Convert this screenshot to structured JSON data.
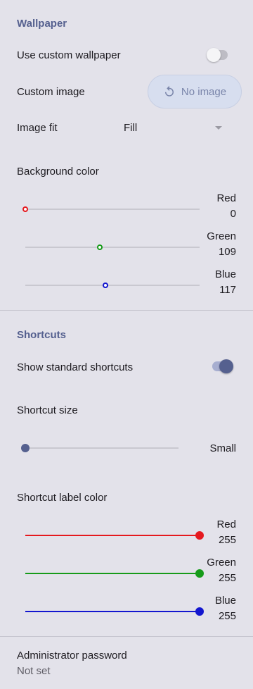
{
  "wallpaper": {
    "section_title": "Wallpaper",
    "use_custom_label": "Use custom wallpaper",
    "use_custom_enabled": false,
    "custom_image_label": "Custom image",
    "no_image_button": "No image",
    "image_fit_label": "Image fit",
    "image_fit_value": "Fill",
    "background_color_label": "Background color",
    "channels": [
      {
        "name": "Red",
        "value": "0",
        "level": 0,
        "color": "#e5191f"
      },
      {
        "name": "Green",
        "value": "109",
        "level": 109,
        "color": "#169b19"
      },
      {
        "name": "Blue",
        "value": "117",
        "level": 117,
        "color": "#1316cf"
      }
    ]
  },
  "shortcuts": {
    "section_title": "Shortcuts",
    "show_standard_label": "Show standard shortcuts",
    "show_standard_enabled": true,
    "size_label": "Shortcut size",
    "size_value": "Small",
    "size_level": 0,
    "label_color_label": "Shortcut label color",
    "channels": [
      {
        "name": "Red",
        "value": "255",
        "level": 255,
        "color": "#e5191f"
      },
      {
        "name": "Green",
        "value": "255",
        "level": 255,
        "color": "#169b19"
      },
      {
        "name": "Blue",
        "value": "255",
        "level": 255,
        "color": "#1316cf"
      }
    ]
  },
  "admin": {
    "password_label": "Administrator password",
    "password_status": "Not set"
  },
  "colors": {
    "accent": "#55608f",
    "background": "#e3e2ea"
  }
}
